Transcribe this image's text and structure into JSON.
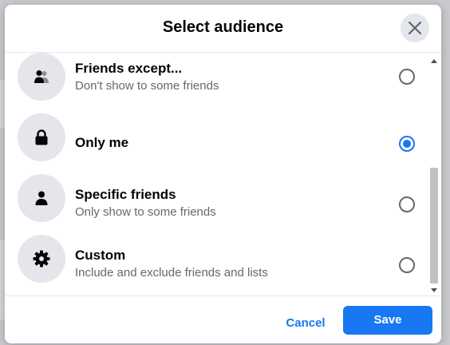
{
  "dialog": {
    "title": "Select audience",
    "close_icon": "close-icon"
  },
  "options": [
    {
      "label": "Friends except...",
      "sub": "Don't show to some friends",
      "icon": "friends-except-icon",
      "selected": false
    },
    {
      "label": "Only me",
      "sub": "",
      "icon": "lock-icon",
      "selected": true
    },
    {
      "label": "Specific friends",
      "sub": "Only show to some friends",
      "icon": "person-icon",
      "selected": false
    },
    {
      "label": "Custom",
      "sub": "Include and exclude friends and lists",
      "icon": "gear-icon",
      "selected": false
    }
  ],
  "footer": {
    "cancel_label": "Cancel",
    "save_label": "Save"
  },
  "colors": {
    "accent": "#1877f2",
    "icon_bg": "#e4e6eb",
    "secondary_text": "#65676b"
  }
}
